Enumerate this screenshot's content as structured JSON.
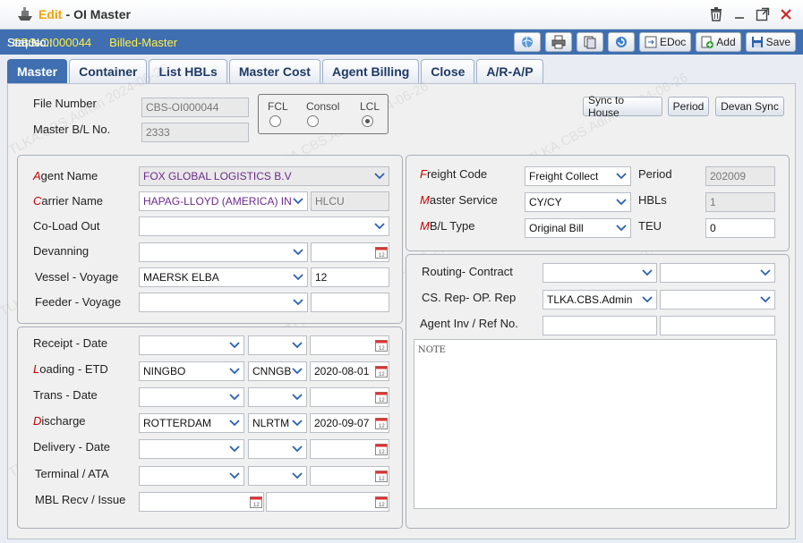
{
  "window": {
    "mode": "Edit",
    "separator": "-",
    "title": "OI Master"
  },
  "infobar": {
    "seq_label": "Seq No.:",
    "seq_value": "CBS-OI000044",
    "status_label": "Status.:",
    "status_value": "Billed-Master",
    "buttons": {
      "edoc": "EDoc",
      "add": "Add",
      "save": "Save"
    }
  },
  "tabs": [
    "Master",
    "Container",
    "List HBLs",
    "Master Cost",
    "Agent Billing",
    "Close",
    "A/R-A/P"
  ],
  "watermark": "TLKA.CBS.Admin 2024-06-26",
  "header": {
    "file_number_label": "File Number",
    "file_number": "CBS-OI000044",
    "master_bl_label": "Master B/L No.",
    "master_bl": "2333",
    "load_type": {
      "fcl": "FCL",
      "consol": "Consol",
      "lcl": "LCL",
      "selected": "LCL"
    },
    "sync_house": "Sync to House",
    "period_btn": "Period",
    "devan_sync": "Devan Sync"
  },
  "party": {
    "agent_first": "A",
    "agent_rest": "gent Name",
    "agent_value": "FOX GLOBAL LOGISTICS B.V",
    "carrier_first": "C",
    "carrier_rest": "arrier Name",
    "carrier_value": "HAPAG-LLOYD (AMERICA) IN",
    "carrier_code": "HLCU",
    "coload_label": "Co-Load Out",
    "devanning_label": "Devanning",
    "vessel_label": "Vessel - Voyage",
    "vessel_value": "MAERSK ELBA",
    "voyage_value": "12",
    "feeder_label": "Feeder - Voyage"
  },
  "route": {
    "receipt_label": "Receipt - Date",
    "loading_first": "L",
    "loading_rest": "oading - ETD",
    "loading_port": "NINGBO",
    "loading_code": "CNNGB",
    "loading_date": "2020-08-01",
    "trans_label": "Trans - Date",
    "discharge_first": "D",
    "discharge_rest": "ischarge",
    "discharge_port": "ROTTERDAM",
    "discharge_code": "NLRTM",
    "discharge_date": "2020-09-07",
    "delivery_label": "Delivery - Date",
    "terminal_label": "Terminal / ATA",
    "mbl_label": "MBL Recv / Issue"
  },
  "freight": {
    "freight_first": "F",
    "freight_rest": "reight Code",
    "freight_value": "Freight Collect",
    "period_label": "Period",
    "period_value": "202009",
    "service_first": "M",
    "service_rest": "aster Service",
    "service_value": "CY/CY",
    "hbls_label": "HBLs",
    "hbls_value": "1",
    "mbl_first": "M",
    "mbl_rest": "B/L Type",
    "mbl_value": "Original Bill",
    "teu_label": "TEU",
    "teu_value": "0"
  },
  "misc": {
    "routing_label": "Routing- Contract",
    "csrep_label": "CS. Rep- OP. Rep",
    "csrep_value": "TLKA.CBS.Admin",
    "agentinv_label": "Agent Inv / Ref No.",
    "note_placeholder": "NOTE"
  }
}
